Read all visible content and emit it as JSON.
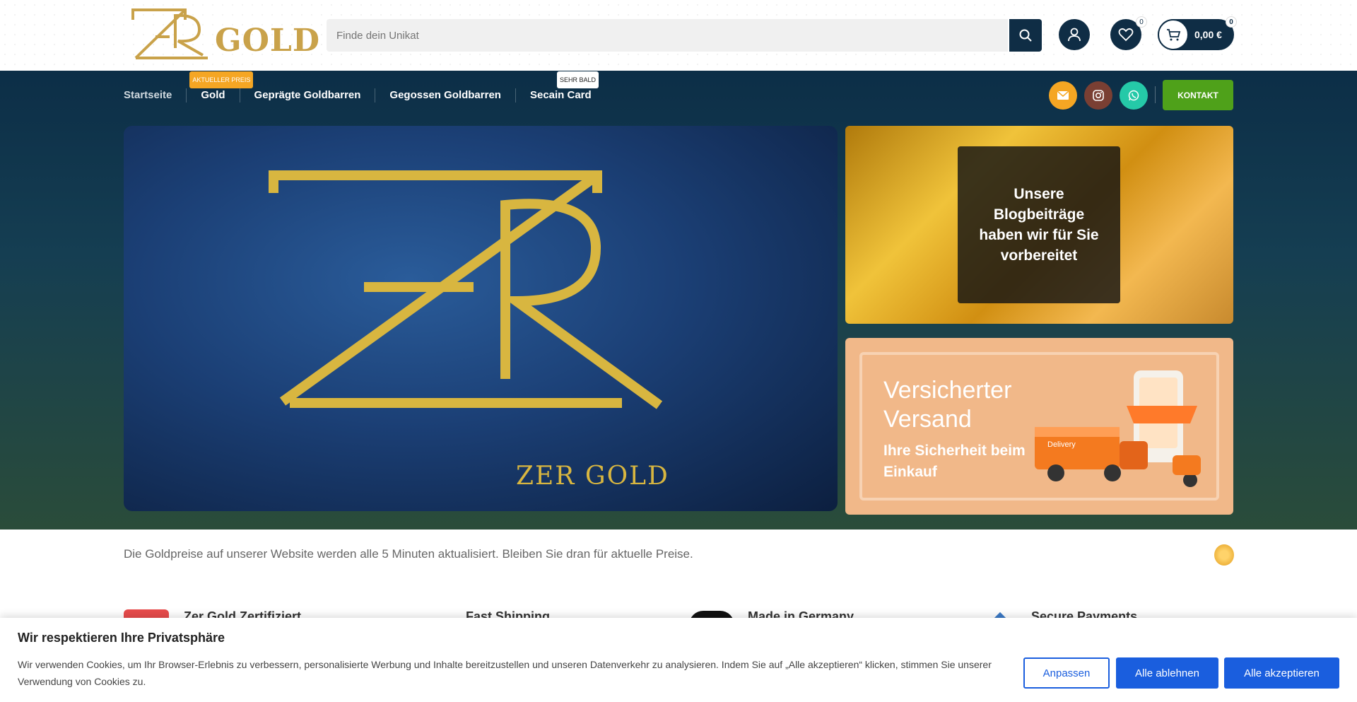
{
  "header": {
    "logo_text": "GOLD",
    "logo_monogram": "ZER",
    "search_placeholder": "Finde dein Unikat",
    "wishlist_count": "0",
    "cart_count": "0",
    "cart_total": "0,00 €"
  },
  "nav": {
    "items": [
      {
        "label": "Startseite"
      },
      {
        "label": "Gold",
        "tag": "AKTUELLER PREIS"
      },
      {
        "label": "Geprägte Goldbarren"
      },
      {
        "label": "Gegossen Goldbarren"
      },
      {
        "label": "Secain Card",
        "tag": "SEHR BALD"
      }
    ],
    "kontakt_label": "KONTAKT",
    "social_colors": {
      "mail": "#f5a623",
      "instagram": "#7a3f33",
      "whatsapp": "#25c9a8"
    }
  },
  "banner": {
    "brand_text": "ZER GOLD"
  },
  "blog_card": {
    "text": "Unsere Blogbeiträge haben wir für Sie vorbereitet"
  },
  "shipping_card": {
    "title": "Versicherter Versand",
    "subtitle": "Ihre Sicherheit beim Einkauf",
    "truck_label": "Delivery"
  },
  "ticker": {
    "text": "Die Goldpreise auf unserer Website werden alle 5 Minuten aktualisiert. Bleiben Sie dran für aktuelle Preise."
  },
  "features": [
    {
      "label": "Zer Gold Zertifiziert"
    },
    {
      "label": "Fast Shipping"
    },
    {
      "label": "Made in Germany"
    },
    {
      "label": "Secure Payments"
    }
  ],
  "cookie": {
    "title": "Wir respektieren Ihre Privatsphäre",
    "text": "Wir verwenden Cookies, um Ihr Browser-Erlebnis zu verbessern, personalisierte Werbung und Inhalte bereitzustellen und unseren Datenverkehr zu analysieren. Indem Sie auf „Alle akzeptieren“ klicken, stimmen Sie unserer Verwendung von Cookies zu.",
    "customize_label": "Anpassen",
    "reject_label": "Alle ablehnen",
    "accept_label": "Alle akzeptieren"
  },
  "colors": {
    "navy": "#0f2d45",
    "gold": "#c9a24a",
    "green": "#4fa11a",
    "blue_button": "#1a5ede"
  }
}
